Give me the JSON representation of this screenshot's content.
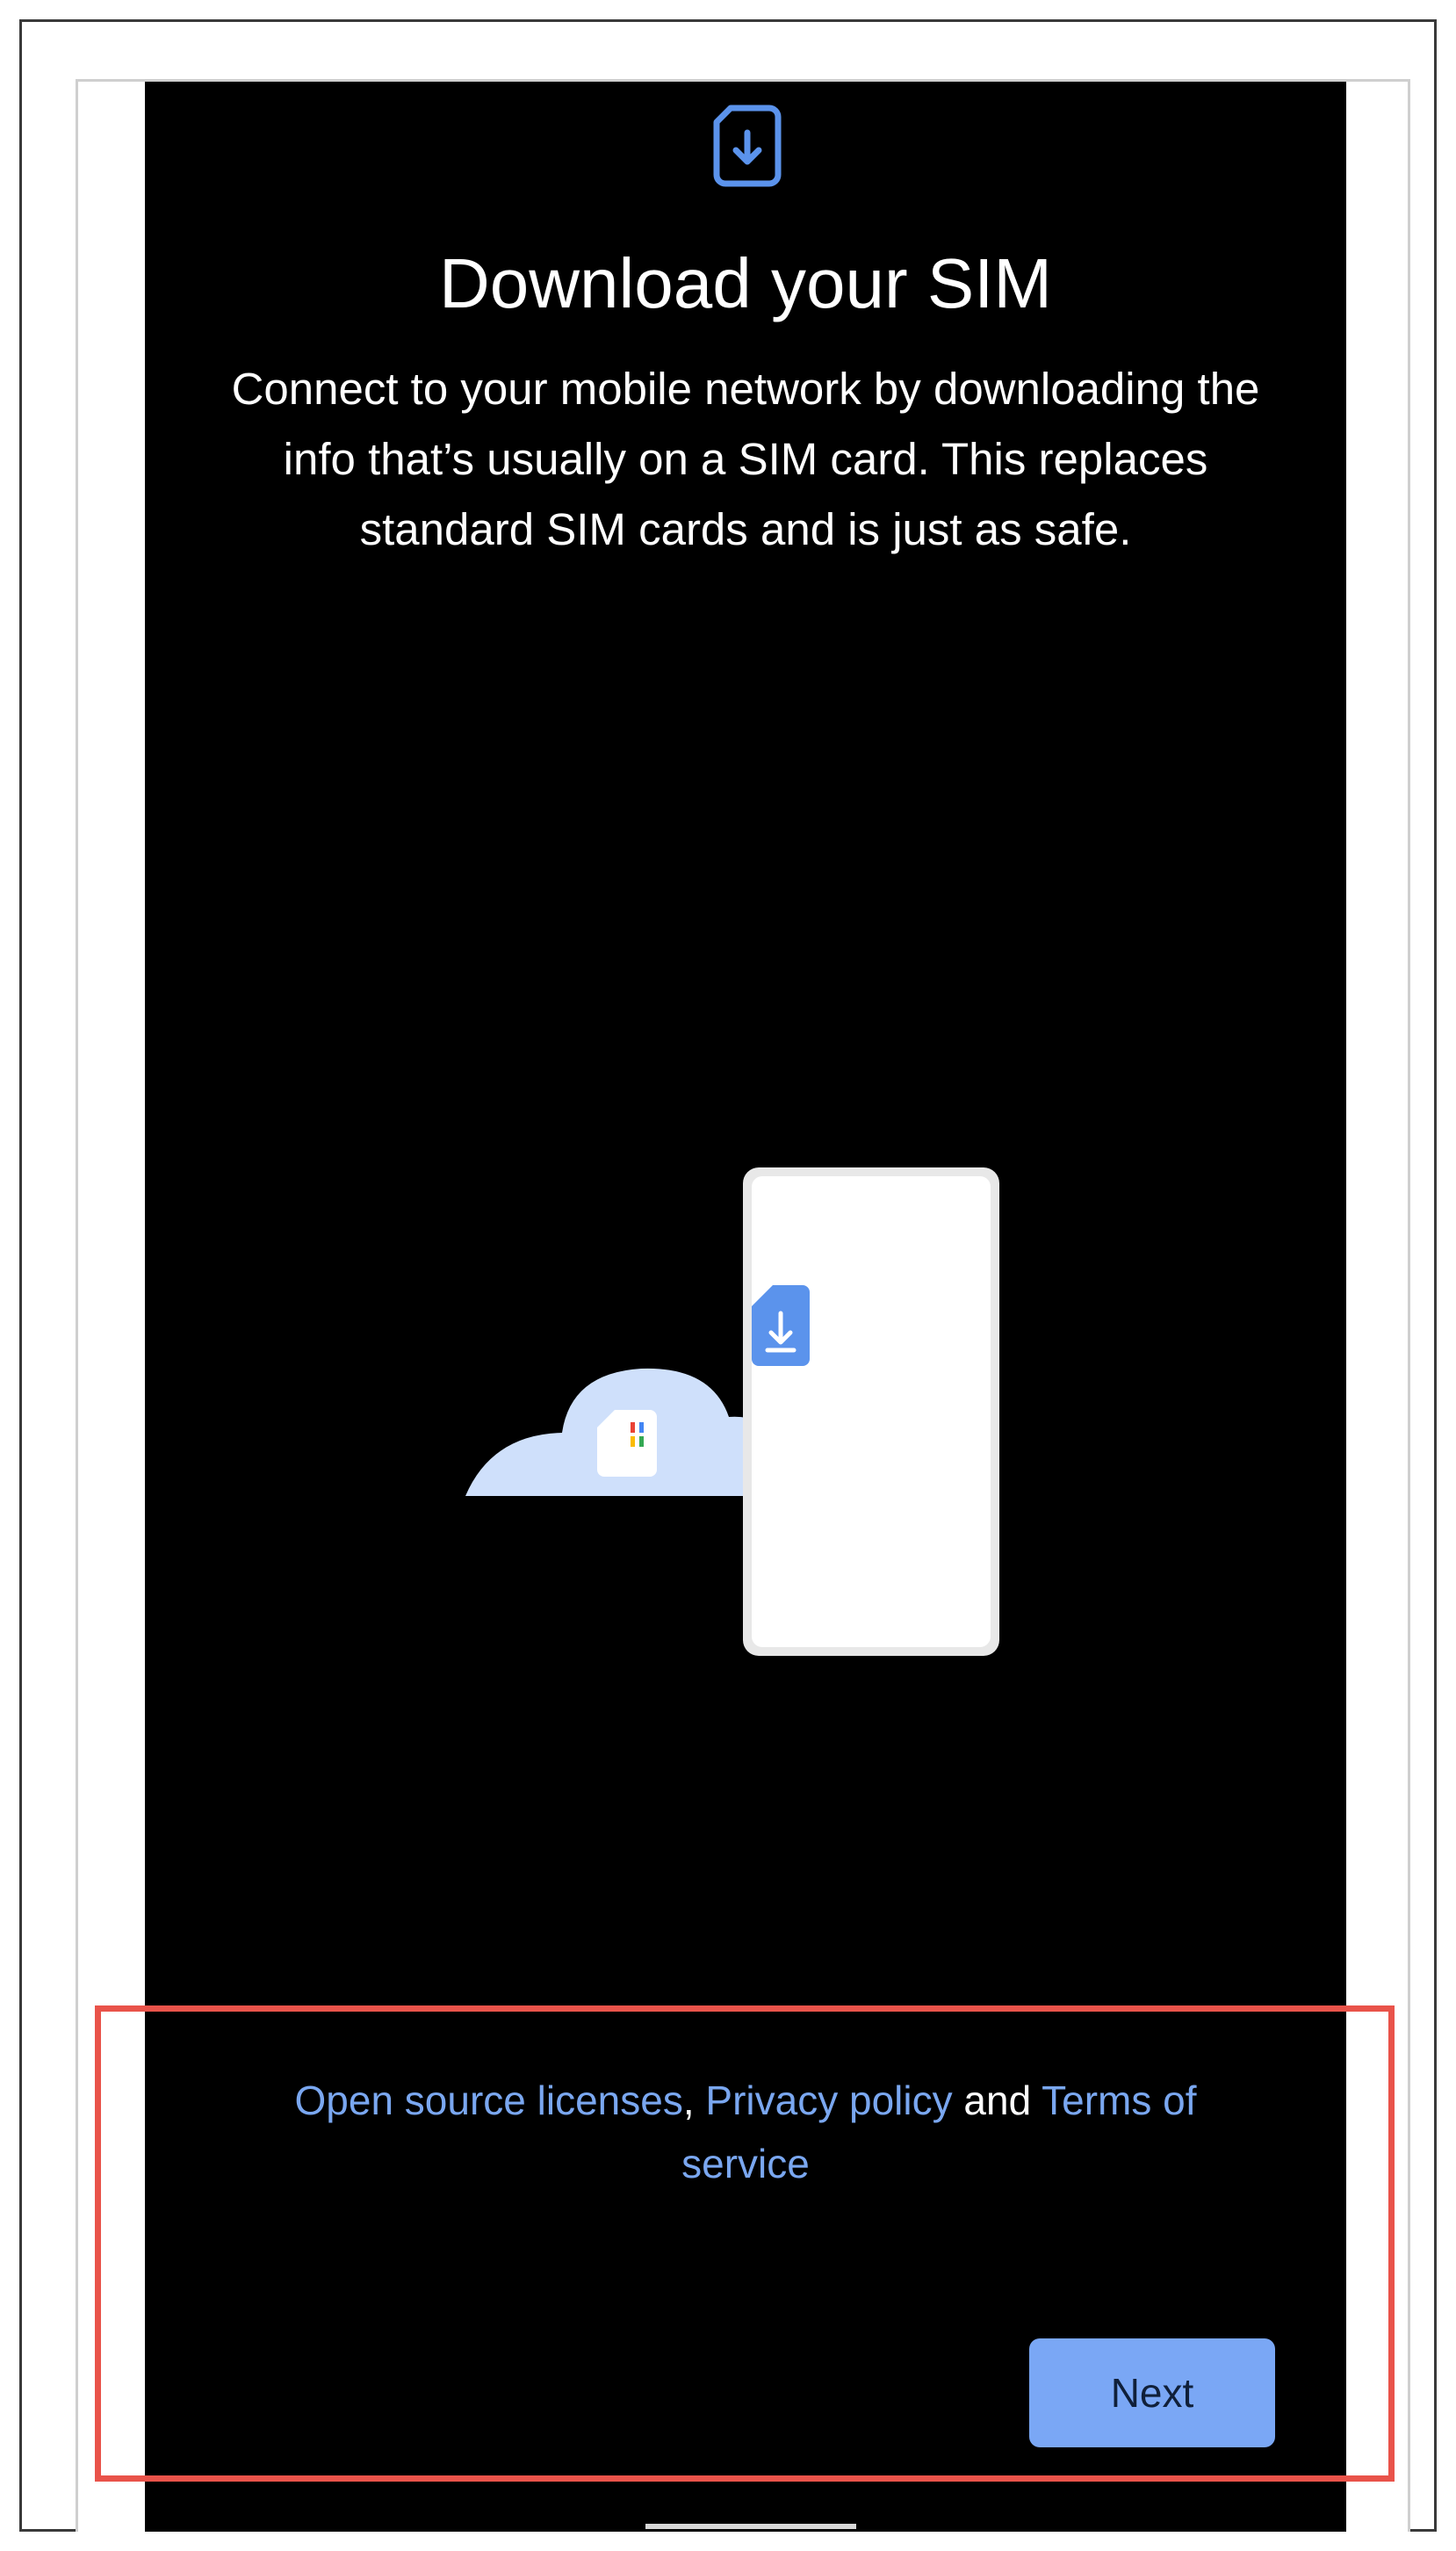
{
  "screen": {
    "title": "Download your SIM",
    "description": "Connect to your mobile network by downloading the info that’s usually on a SIM card. This replaces standard SIM cards and is just as safe.",
    "top_icon": "sim-download-icon",
    "illustration": "cloud-sim-to-phone-illustration"
  },
  "legal": {
    "open_source_label": "Open source licenses",
    "separator": ",",
    "privacy_label": "Privacy policy",
    "and_label": "and",
    "terms_label": "Terms of service"
  },
  "actions": {
    "next_label": "Next"
  },
  "colors": {
    "background": "#000000",
    "link": "#7aa7f0",
    "button": "#7aa7f5",
    "highlight": "#e9534a",
    "icon_blue": "#5b93ec",
    "cloud": "#cfe0fb"
  }
}
